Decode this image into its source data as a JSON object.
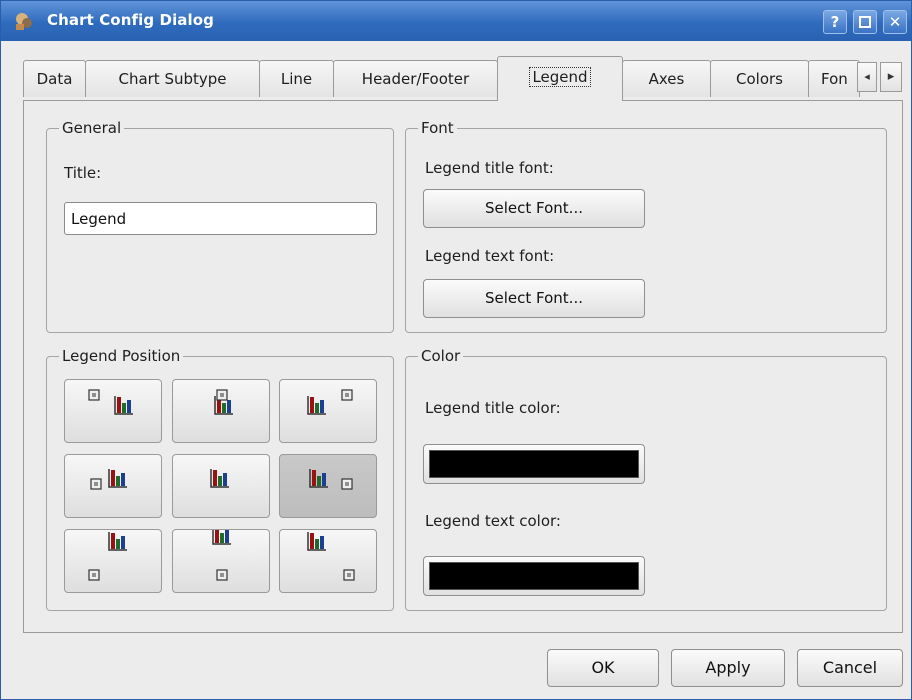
{
  "window": {
    "title": "Chart Config Dialog",
    "help_label": "?",
    "close_label": "✕"
  },
  "tabs": [
    {
      "label": "Data"
    },
    {
      "label": "Chart Subtype"
    },
    {
      "label": "Line"
    },
    {
      "label": "Header/Footer"
    },
    {
      "label": "Legend",
      "active": true
    },
    {
      "label": "Axes"
    },
    {
      "label": "Colors"
    },
    {
      "label": "Fon"
    }
  ],
  "tab_scroll": {
    "left": "◂",
    "right": "▸"
  },
  "general": {
    "title": "General",
    "title_label": "Title:",
    "title_value": "Legend"
  },
  "font": {
    "title": "Font",
    "legend_title_font_label": "Legend title font:",
    "select_font_1": "Select Font...",
    "legend_text_font_label": "Legend text font:",
    "select_font_2": "Select Font..."
  },
  "legend_position": {
    "title": "Legend Position",
    "options": [
      "top-left",
      "top",
      "top-right",
      "left",
      "center",
      "right",
      "bottom-left",
      "bottom",
      "bottom-right"
    ],
    "selected": "right"
  },
  "color": {
    "title": "Color",
    "legend_title_color_label": "Legend title color:",
    "legend_title_color": "#000000",
    "legend_text_color_label": "Legend text color:",
    "legend_text_color": "#000000"
  },
  "buttons": {
    "ok": "OK",
    "apply": "Apply",
    "cancel": "Cancel"
  }
}
